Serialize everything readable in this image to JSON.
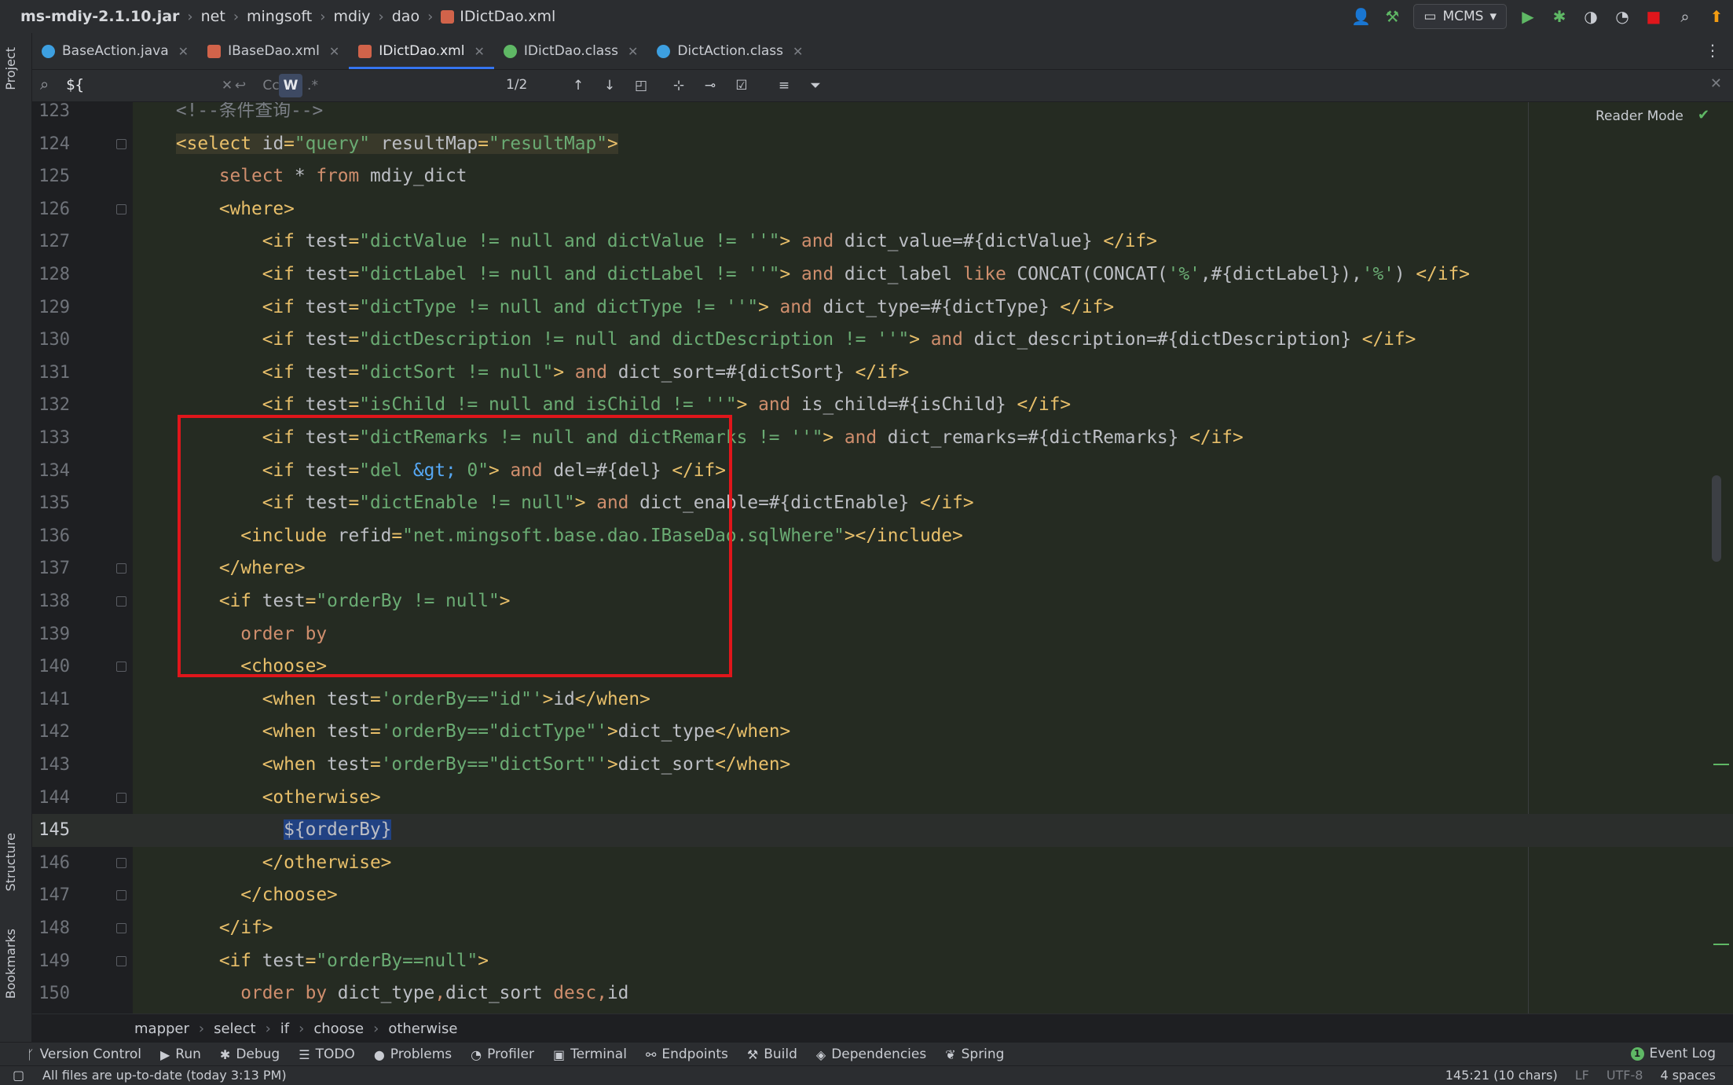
{
  "breadcrumbs": [
    "ms-mdiy-2.1.10.jar",
    "net",
    "mingsoft",
    "mdiy",
    "dao",
    "IDictDao.xml"
  ],
  "run_config": "MCMS",
  "left_panels": {
    "project": "Project",
    "structure": "Structure",
    "bookmarks": "Bookmarks"
  },
  "tabs": [
    {
      "label": "BaseAction.java",
      "icon_color": "#3d9fe0"
    },
    {
      "label": "IBaseDao.xml",
      "icon_color": "#d1634a"
    },
    {
      "label": "IDictDao.xml",
      "icon_color": "#d1634a",
      "active": true
    },
    {
      "label": "IDictDao.class",
      "icon_color": "#5fb865"
    },
    {
      "label": "DictAction.class",
      "icon_color": "#3d9fe0"
    }
  ],
  "search": {
    "query": "${",
    "match_case": "Cc",
    "words": "W",
    "regex": ".*",
    "matches": "1/2"
  },
  "reader_mode": "Reader Mode",
  "code_lines": [
    {
      "n": "123",
      "html": "<span class=\"cmt\">&lt;!--条件查询--&gt;</span>"
    },
    {
      "n": "124",
      "html": "<span class=\"tagbg\"><span class=\"tag\">&lt;select </span><span class=\"attr\">id</span><span class=\"tag\">=</span><span class=\"val\">\"query\"</span> <span class=\"attr\">resultMap</span><span class=\"tag\">=</span><span class=\"val\">\"resultMap\"</span><span class=\"tag\">&gt;</span></span>"
    },
    {
      "n": "125",
      "html": "    <span class=\"kw\">select</span> * <span class=\"kw\">from</span> mdiy_dict"
    },
    {
      "n": "126",
      "html": "    <span class=\"tag\">&lt;where&gt;</span>"
    },
    {
      "n": "127",
      "html": "        <span class=\"tag\">&lt;if </span><span class=\"attr\">test</span><span class=\"tag\">=</span><span class=\"val\">\"dictValue != null and dictValue != ''\"</span><span class=\"tag\">&gt;</span> <span class=\"kw\">and</span> dict_value=#{dictValue} <span class=\"tag\">&lt;/if&gt;</span>"
    },
    {
      "n": "128",
      "html": "        <span class=\"tag\">&lt;if </span><span class=\"attr\">test</span><span class=\"tag\">=</span><span class=\"val\">\"dictLabel != null and dictLabel != ''\"</span><span class=\"tag\">&gt;</span> <span class=\"kw\">and</span> dict_label <span class=\"kw\">like</span> CONCAT(CONCAT(<span class=\"val\">'%'</span>,#{dictLabel}),<span class=\"val\">'%'</span>) <span class=\"tag\">&lt;/if&gt;</span>"
    },
    {
      "n": "129",
      "html": "        <span class=\"tag\">&lt;if </span><span class=\"attr\">test</span><span class=\"tag\">=</span><span class=\"val\">\"dictType != null and dictType != ''\"</span><span class=\"tag\">&gt;</span> <span class=\"kw\">and</span> dict_type=#{dictType} <span class=\"tag\">&lt;/if&gt;</span>"
    },
    {
      "n": "130",
      "html": "        <span class=\"tag\">&lt;if </span><span class=\"attr\">test</span><span class=\"tag\">=</span><span class=\"val\">\"dictDescription != null and dictDescription != ''\"</span><span class=\"tag\">&gt;</span> <span class=\"kw\">and</span> dict_description=#{dictDescription} <span class=\"tag\">&lt;/if&gt;</span>"
    },
    {
      "n": "131",
      "html": "        <span class=\"tag\">&lt;if </span><span class=\"attr\">test</span><span class=\"tag\">=</span><span class=\"val\">\"dictSort != null\"</span><span class=\"tag\">&gt;</span> <span class=\"kw\">and</span> dict_sort=#{dictSort} <span class=\"tag\">&lt;/if&gt;</span>"
    },
    {
      "n": "132",
      "html": "        <span class=\"tag\">&lt;if </span><span class=\"attr\">test</span><span class=\"tag\">=</span><span class=\"val\">\"isChild != null and isChild != ''\"</span><span class=\"tag\">&gt;</span> <span class=\"kw\">and</span> is_child=#{isChild} <span class=\"tag\">&lt;/if&gt;</span>"
    },
    {
      "n": "133",
      "html": "        <span class=\"tag\">&lt;if </span><span class=\"attr\">test</span><span class=\"tag\">=</span><span class=\"val\">\"dictRemarks != null and dictRemarks != ''\"</span><span class=\"tag\">&gt;</span> <span class=\"kw\">and</span> dict_remarks=#{dictRemarks} <span class=\"tag\">&lt;/if&gt;</span>"
    },
    {
      "n": "134",
      "html": "        <span class=\"tag\">&lt;if </span><span class=\"attr\">test</span><span class=\"tag\">=</span><span class=\"val\">\"del <span class=\"ent\">&amp;gt;</span> 0\"</span><span class=\"tag\">&gt;</span> <span class=\"kw\">and</span> del=#{del} <span class=\"tag\">&lt;/if&gt;</span>"
    },
    {
      "n": "135",
      "html": "        <span class=\"tag\">&lt;if </span><span class=\"attr\">test</span><span class=\"tag\">=</span><span class=\"val\">\"dictEnable != null\"</span><span class=\"tag\">&gt;</span> <span class=\"kw\">and</span> dict_enable=#{dictEnable} <span class=\"tag\">&lt;/if&gt;</span>"
    },
    {
      "n": "136",
      "html": "      <span class=\"tag\">&lt;include </span><span class=\"attr\">refid</span><span class=\"tag\">=</span><span class=\"val\">\"net.mingsoft.base.dao.IBaseDao.sqlWhere\"</span><span class=\"tag\">&gt;&lt;/include&gt;</span>"
    },
    {
      "n": "137",
      "html": "    <span class=\"tag\">&lt;/where&gt;</span>"
    },
    {
      "n": "138",
      "html": "    <span class=\"tag\">&lt;if </span><span class=\"attr\">test</span><span class=\"tag\">=</span><span class=\"val\">\"orderBy != null\"</span><span class=\"tag\">&gt;</span>"
    },
    {
      "n": "139",
      "html": "      <span class=\"kw\">order by</span>"
    },
    {
      "n": "140",
      "html": "      <span class=\"tag\">&lt;choose&gt;</span>"
    },
    {
      "n": "141",
      "html": "        <span class=\"tag\">&lt;when </span><span class=\"attr\">test</span><span class=\"tag\">=</span><span class=\"val\">'orderBy==\"id\"'</span><span class=\"tag\">&gt;</span>id<span class=\"tag\">&lt;/when&gt;</span>"
    },
    {
      "n": "142",
      "html": "        <span class=\"tag\">&lt;when </span><span class=\"attr\">test</span><span class=\"tag\">=</span><span class=\"val\">'orderBy==\"dictType\"'</span><span class=\"tag\">&gt;</span>dict_type<span class=\"tag\">&lt;/when&gt;</span>"
    },
    {
      "n": "143",
      "html": "        <span class=\"tag\">&lt;when </span><span class=\"attr\">test</span><span class=\"tag\">=</span><span class=\"val\">'orderBy==\"dictSort\"'</span><span class=\"tag\">&gt;</span>dict_sort<span class=\"tag\">&lt;/when&gt;</span>"
    },
    {
      "n": "144",
      "html": "        <span class=\"tag\">&lt;otherwise&gt;</span>"
    },
    {
      "n": "145",
      "html": "          <span class=\"sel\">${orderBy}</span>",
      "current": true
    },
    {
      "n": "146",
      "html": "        <span class=\"tag\">&lt;/otherwise&gt;</span>"
    },
    {
      "n": "147",
      "html": "      <span class=\"tag\">&lt;/choose&gt;</span>"
    },
    {
      "n": "148",
      "html": "    <span class=\"tag\">&lt;/if&gt;</span>"
    },
    {
      "n": "149",
      "html": "    <span class=\"tag\">&lt;if </span><span class=\"attr\">test</span><span class=\"tag\">=</span><span class=\"val\">\"orderBy==null\"</span><span class=\"tag\">&gt;</span>"
    },
    {
      "n": "150",
      "html": "      <span class=\"kw\">order by</span> dict_type<span class=\"kw\">,</span>dict_sort <span class=\"kw\">desc</span><span class=\"kw\">,</span>id"
    }
  ],
  "xml_path": [
    "mapper",
    "select",
    "if",
    "choose",
    "otherwise"
  ],
  "tool_windows": [
    {
      "label": "Version Control",
      "icon": "branch-icon",
      "glyph": "ᚴ"
    },
    {
      "label": "Run",
      "icon": "play-icon",
      "glyph": "▶"
    },
    {
      "label": "Debug",
      "icon": "bug-icon",
      "glyph": "✱"
    },
    {
      "label": "TODO",
      "icon": "list-icon",
      "glyph": "☰"
    },
    {
      "label": "Problems",
      "icon": "info-icon",
      "glyph": "●"
    },
    {
      "label": "Profiler",
      "icon": "profiler-icon",
      "glyph": "◔"
    },
    {
      "label": "Terminal",
      "icon": "terminal-icon",
      "glyph": "▣"
    },
    {
      "label": "Endpoints",
      "icon": "endpoints-icon",
      "glyph": "⚯"
    },
    {
      "label": "Build",
      "icon": "hammer-icon",
      "glyph": "⚒"
    },
    {
      "label": "Dependencies",
      "icon": "layers-icon",
      "glyph": "◈"
    },
    {
      "label": "Spring",
      "icon": "leaf-icon",
      "glyph": "❦"
    }
  ],
  "event_log": {
    "label": "Event Log",
    "count": "1"
  },
  "status": {
    "message": "All files are up-to-date (today 3:13 PM)",
    "position": "145:21 (10 chars)",
    "line_sep": "LF",
    "encoding": "UTF-8",
    "indent": "4 spaces"
  }
}
